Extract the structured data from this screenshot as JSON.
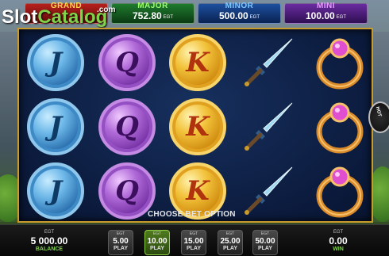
{
  "watermark": {
    "text_main": "Slot",
    "text_accent": "Catalog",
    "suffix": ".com"
  },
  "jackpots": [
    {
      "id": "grand",
      "title": "GRAND",
      "value": "",
      "currency": ""
    },
    {
      "id": "major",
      "title": "MAJOR",
      "value": "752.80",
      "currency": "EGT"
    },
    {
      "id": "minor",
      "title": "MINOR",
      "value": "500.00",
      "currency": "EGT"
    },
    {
      "id": "mini",
      "title": "MINI",
      "value": "100.00",
      "currency": "EGT"
    }
  ],
  "reels": [
    [
      "J",
      "J",
      "J"
    ],
    [
      "Q",
      "Q",
      "Q"
    ],
    [
      "K",
      "K",
      "K"
    ],
    [
      "dagger",
      "dagger",
      "dagger"
    ],
    [
      "ring",
      "ring",
      "ring"
    ]
  ],
  "prompt": "CHOOSE BET OPTION",
  "balance": {
    "currency": "EGT",
    "value": "5 000.00",
    "label": "BALANCE"
  },
  "bets": [
    {
      "currency": "EGT",
      "amount": "5.00",
      "label": "PLAY",
      "selected": false
    },
    {
      "currency": "EGT",
      "amount": "10.00",
      "label": "PLAY",
      "selected": true
    },
    {
      "currency": "EGT",
      "amount": "15.00",
      "label": "PLAY",
      "selected": false
    },
    {
      "currency": "EGT",
      "amount": "25.00",
      "label": "PLAY",
      "selected": false
    },
    {
      "currency": "EGT",
      "amount": "50.00",
      "label": "PLAY",
      "selected": false
    }
  ],
  "win": {
    "currency": "EGT",
    "value": "0.00",
    "label": "WIN"
  },
  "side_badge": {
    "text": "HOT"
  },
  "colors": {
    "frame": "#c99a2c",
    "selected_bet": "#8ed046",
    "label_accent": "#7fd24a"
  }
}
